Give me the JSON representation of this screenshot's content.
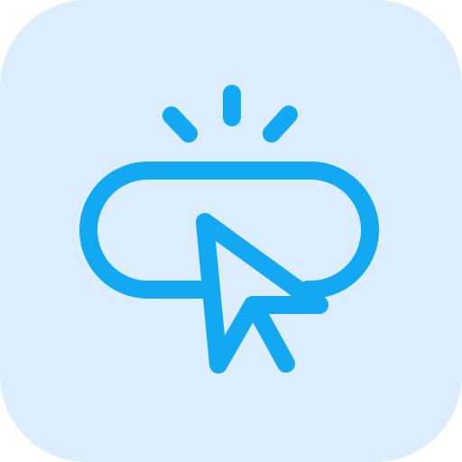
{
  "icon": {
    "name": "button-click-icon",
    "background_color": "#DCEEFD",
    "stroke_color": "#12A8F2",
    "elements": [
      "rounded-pill-button",
      "mouse-pointer-arrow",
      "click-burst-lines"
    ]
  }
}
